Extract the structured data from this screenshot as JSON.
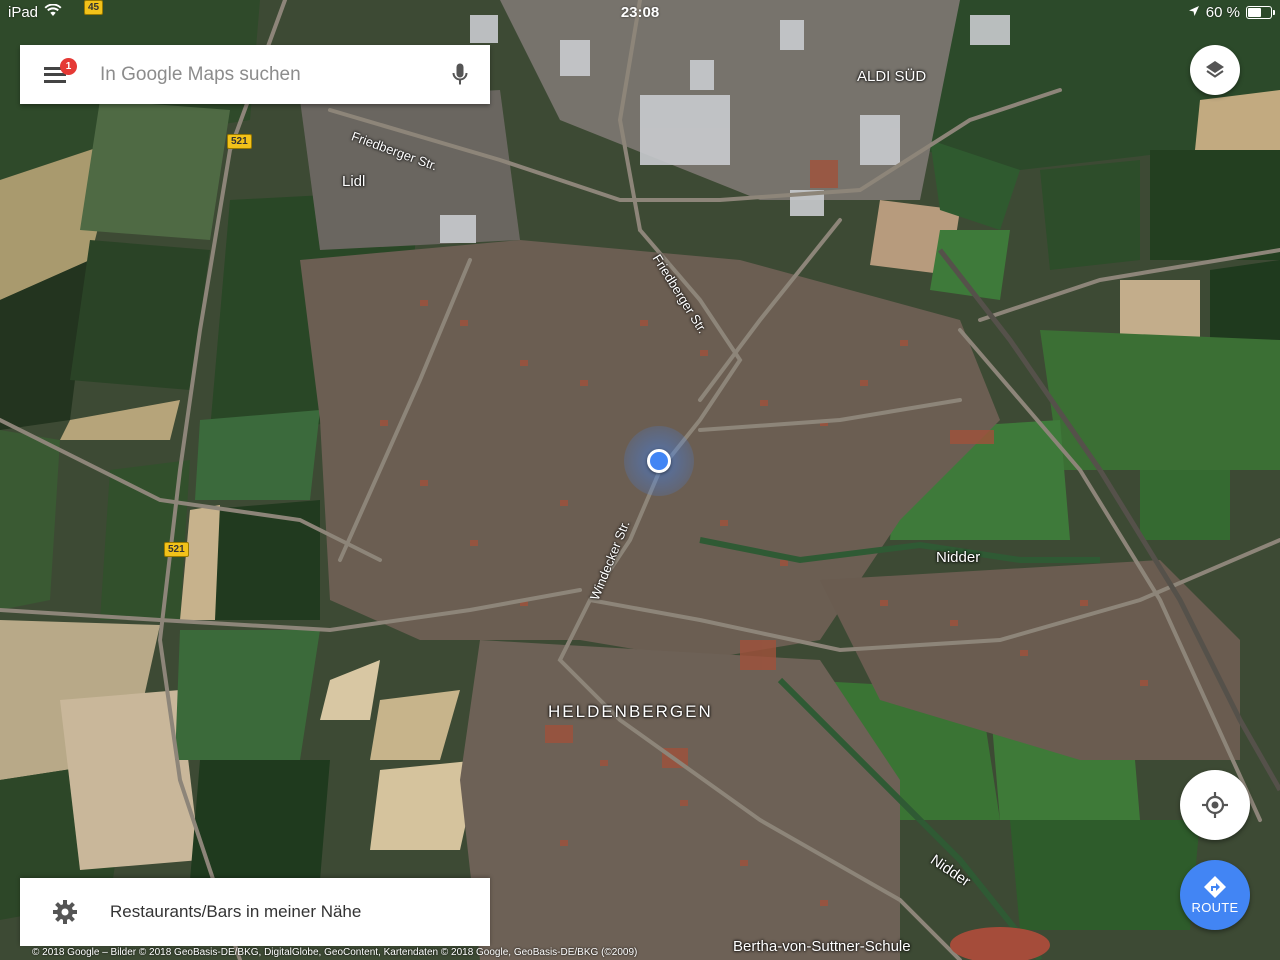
{
  "status_bar": {
    "device": "iPad",
    "time": "23:08",
    "battery": "60 %",
    "battery_level": 0.6
  },
  "search": {
    "placeholder": "In Google Maps suchen",
    "notification_count": "1"
  },
  "map": {
    "labels": {
      "aldi": "ALDI SÜD",
      "lidl": "Lidl",
      "friedberger_1": "Friedberger Str.",
      "friedberger_2": "Friedberger Str.",
      "windecker": "Windecker Str.",
      "town": "HELDENBERGEN",
      "nidder_1": "Nidder",
      "nidder_2": "Nidder",
      "school": "Bertha-von-Suttner-Schule",
      "route_45": "45",
      "route_521_a": "521",
      "route_521_b": "521"
    }
  },
  "controls": {
    "route_label": "ROUTE"
  },
  "nearby": {
    "label": "Restaurants/Bars in meiner Nähe"
  },
  "copyright": "© 2018 Google – Bilder © 2018 GeoBasis-DE/BKG, DigitalGlobe, GeoContent, Kartendaten © 2018 Google, GeoBasis-DE/BKG (©2009)",
  "colors": {
    "accent": "#4285f4",
    "badge": "#e53935"
  }
}
